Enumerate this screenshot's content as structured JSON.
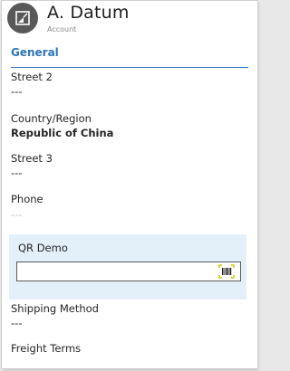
{
  "header": {
    "title": "A. Datum",
    "subtitle": "Account"
  },
  "section": {
    "tab_label": "General"
  },
  "fields": {
    "street2": {
      "label": "Street 2",
      "value": "---"
    },
    "country": {
      "label": "Country/Region",
      "value": "Republic of China"
    },
    "street3": {
      "label": "Street 3",
      "value": "---"
    },
    "phone": {
      "label": "Phone",
      "value": "---"
    },
    "shipping": {
      "label": "Shipping Method",
      "value": "---"
    },
    "freight": {
      "label": "Freight Terms"
    }
  },
  "qr": {
    "label": "QR Demo",
    "value": "",
    "scan_icon": "barcode-scan-icon"
  },
  "colors": {
    "accent": "#2e75b6",
    "qr_panel_bg": "#e3f0fa",
    "scan_icon": "#c6d200",
    "avatar_bg": "#595959"
  }
}
